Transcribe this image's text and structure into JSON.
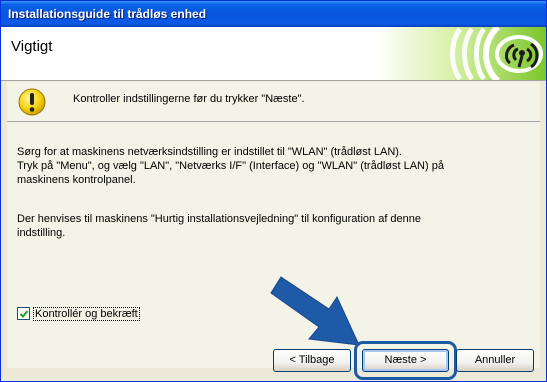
{
  "window": {
    "title": "Installationsguide til trådløs enhed"
  },
  "header": {
    "title": "Vigtigt",
    "logo_icon": "wireless-logo-icon"
  },
  "notice": {
    "icon": "warning-icon",
    "text": "Kontroller indstillingerne før du trykker \"Næste\"."
  },
  "body": {
    "paragraph1_lines": [
      "Sørg for at maskinens netværksindstilling er indstillet til \"WLAN\" (trådløst LAN).",
      "Tryk på \"Menu\", og vælg \"LAN\", \"Netværks I/F\" (Interface) og \"WLAN\" (trådløst LAN) på",
      "maskinens kontrolpanel."
    ],
    "paragraph2_lines": [
      "Der henvises til maskinens \"Hurtig installationsvejledning\" til konfiguration af denne",
      "indstilling."
    ]
  },
  "confirm": {
    "label": "Kontrollér og bekræft",
    "checked": true
  },
  "buttons": {
    "back": "< Tilbage",
    "next": "Næste >",
    "cancel": "Annuller"
  },
  "colors": {
    "titlebar": "#0855dd",
    "accent_arrow": "#1f5aa8",
    "logo_green": "#6bbf1f"
  }
}
